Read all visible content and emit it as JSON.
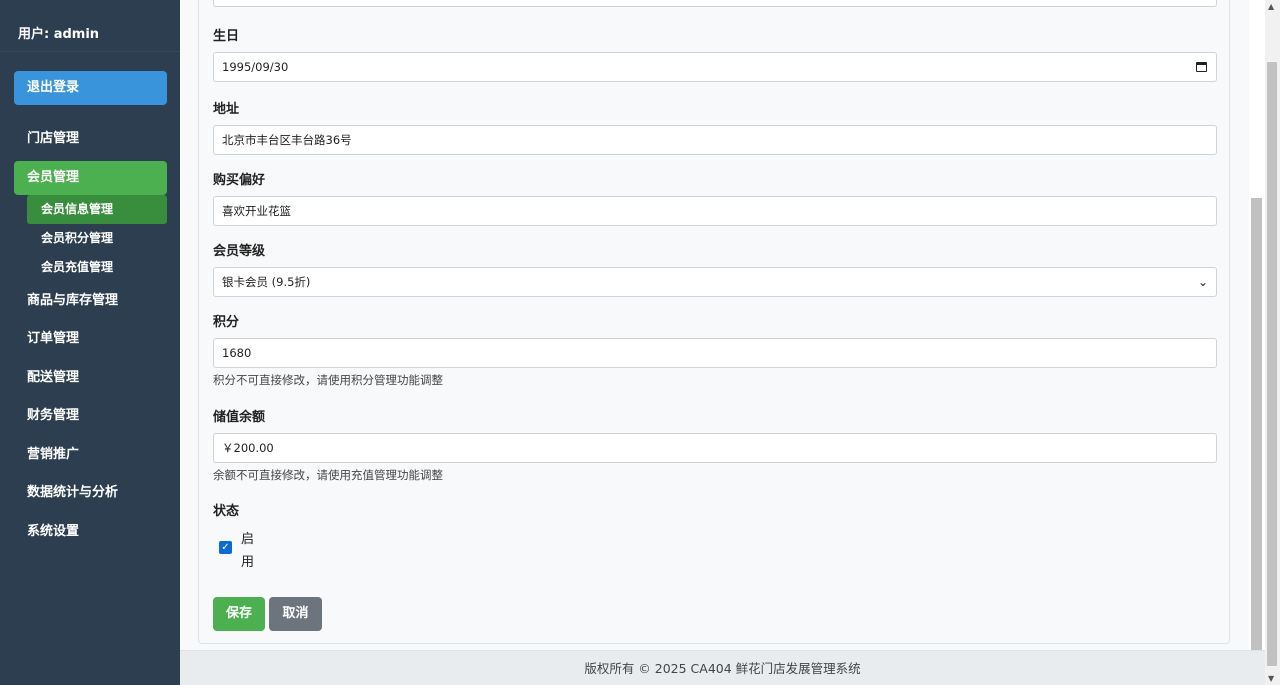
{
  "sidebar": {
    "user": "用户: admin",
    "logout": "退出登录",
    "menu": [
      "门店管理",
      "会员管理",
      "商品与库存管理",
      "订单管理",
      "配送管理",
      "财务管理",
      "营销推广",
      "数据统计与分析",
      "系统设置"
    ],
    "submenu": [
      "会员信息管理",
      "会员积分管理",
      "会员充值管理"
    ]
  },
  "form": {
    "birthday_label": "生日",
    "birthday_value": "1995/09/30",
    "address_label": "地址",
    "address_value": "北京市丰台区丰台路36号",
    "preference_label": "购买偏好",
    "preference_value": "喜欢开业花篮",
    "level_label": "会员等级",
    "level_value": "银卡会员 (9.5折)",
    "points_label": "积分",
    "points_value": "1680",
    "points_hint": "积分不可直接修改，请使用积分管理功能调整",
    "balance_label": "储值余额",
    "balance_value": "￥200.00",
    "balance_hint": "余额不可直接修改，请使用充值管理功能调整",
    "status_label": "状态",
    "status_checkbox_label": "启用",
    "status_checked": true,
    "save_button": "保存",
    "cancel_button": "取消"
  },
  "footer": {
    "text": "版权所有 © 2025 CA404 鲜花门店发展管理系统"
  },
  "colors": {
    "sidebar_bg": "#2c3e50",
    "logout_bg": "#3a94dc",
    "active_menu": "#4caf50",
    "active_submenu": "#388e3c",
    "save_button": "#4caf50",
    "cancel_button": "#6c757d"
  }
}
